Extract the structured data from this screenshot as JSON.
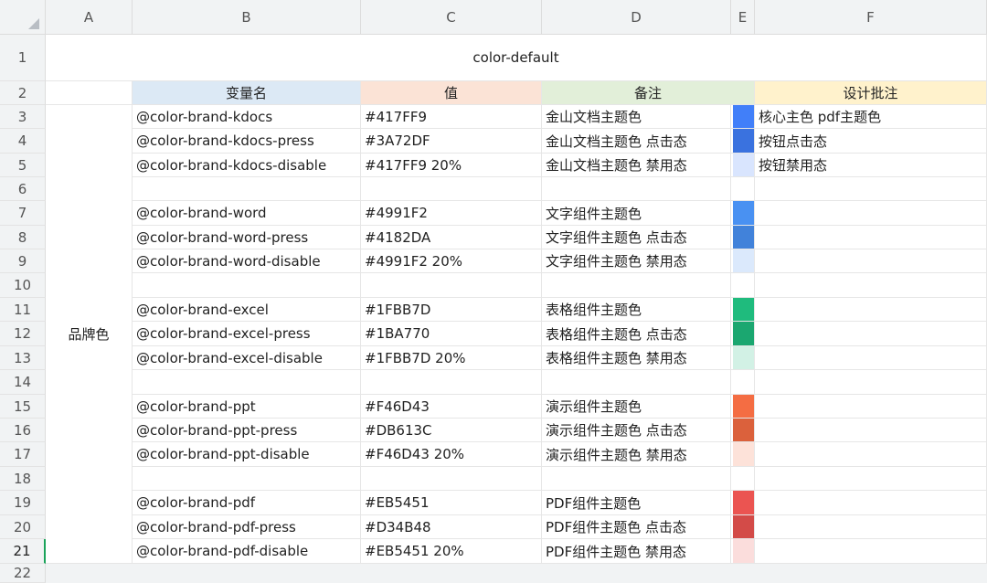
{
  "columns": [
    "A",
    "B",
    "C",
    "D",
    "E",
    "F"
  ],
  "rows": [
    "1",
    "2",
    "3",
    "4",
    "5",
    "6",
    "7",
    "8",
    "9",
    "10",
    "11",
    "12",
    "13",
    "14",
    "15",
    "16",
    "17",
    "18",
    "19",
    "20",
    "21",
    "22"
  ],
  "sheet_title": "color-default",
  "headers": {
    "name": "变量名",
    "value": "值",
    "note": "备注",
    "design": "设计批注"
  },
  "header_colors": {
    "name": "#dce9f5",
    "value": "#fbe3d6",
    "note": "#e2efd9",
    "design": "#fff2cc"
  },
  "group_label": "品牌色",
  "entries": [
    {
      "name": "@color-brand-kdocs",
      "value": "#417FF9",
      "note": "金山文档主题色",
      "design": "核心主色  pdf主题色",
      "swatch": "#417FF9"
    },
    {
      "name": "@color-brand-kdocs-press",
      "value": "#3A72DF",
      "note": "金山文档主题色  点击态",
      "design": "按钮点击态",
      "swatch": "#3A72DF"
    },
    {
      "name": "@color-brand-kdocs-disable",
      "value": "#417FF9  20%",
      "note": "金山文档主题色  禁用态",
      "design": "按钮禁用态",
      "swatch": "#d9e5fe"
    },
    {
      "name": "",
      "value": "",
      "note": "",
      "design": "",
      "swatch": ""
    },
    {
      "name": "@color-brand-word",
      "value": "#4991F2",
      "note": "文字组件主题色",
      "design": "",
      "swatch": "#4991F2"
    },
    {
      "name": "@color-brand-word-press",
      "value": "#4182DA",
      "note": "文字组件主题色  点击态",
      "design": "",
      "swatch": "#4182DA"
    },
    {
      "name": "@color-brand-word-disable",
      "value": "#4991F2  20%",
      "note": "文字组件主题色  禁用态",
      "design": "",
      "swatch": "#dbe9fc"
    },
    {
      "name": "",
      "value": "",
      "note": "",
      "design": "",
      "swatch": ""
    },
    {
      "name": "@color-brand-excel",
      "value": "#1FBB7D",
      "note": "表格组件主题色",
      "design": "",
      "swatch": "#1FBB7D"
    },
    {
      "name": "@color-brand-excel-press",
      "value": "#1BA770",
      "note": "表格组件主题色  点击态",
      "design": "",
      "swatch": "#1BA770"
    },
    {
      "name": "@color-brand-excel-disable",
      "value": "#1FBB7D  20%",
      "note": "表格组件主题色  禁用态",
      "design": "",
      "swatch": "#d2f1e5"
    },
    {
      "name": "",
      "value": "",
      "note": "",
      "design": "",
      "swatch": ""
    },
    {
      "name": "@color-brand-ppt",
      "value": "#F46D43",
      "note": "演示组件主题色",
      "design": "",
      "swatch": "#F46D43"
    },
    {
      "name": "@color-brand-ppt-press",
      "value": "#DB613C",
      "note": "演示组件主题色  点击态",
      "design": "",
      "swatch": "#DB613C"
    },
    {
      "name": "@color-brand-ppt-disable",
      "value": "#F46D43  20%",
      "note": "演示组件主题色  禁用态",
      "design": "",
      "swatch": "#fde2d9"
    },
    {
      "name": "",
      "value": "",
      "note": "",
      "design": "",
      "swatch": ""
    },
    {
      "name": "@color-brand-pdf",
      "value": "#EB5451",
      "note": "PDF组件主题色",
      "design": "",
      "swatch": "#EB5451"
    },
    {
      "name": "@color-brand-pdf-press",
      "value": "#D34B48",
      "note": "PDF组件主题色  点击态",
      "design": "",
      "swatch": "#D34B48"
    },
    {
      "name": "@color-brand-pdf-disable",
      "value": "#EB5451  20%",
      "note": "PDF组件主题色  禁用态",
      "design": "",
      "swatch": "#fbdddc"
    }
  ]
}
